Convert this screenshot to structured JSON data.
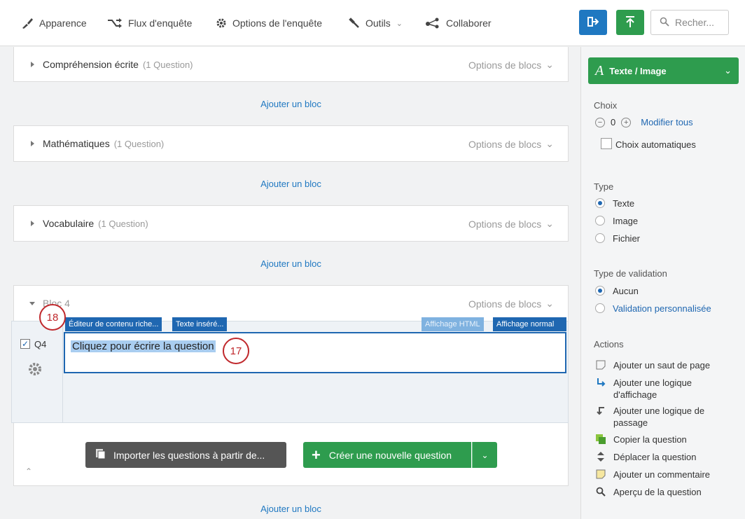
{
  "nav": {
    "apparence": "Apparence",
    "flux": "Flux d'enquête",
    "options": "Options de l'enquête",
    "outils": "Outils",
    "collaborer": "Collaborer"
  },
  "search": {
    "placeholder": "Recher..."
  },
  "blocks": [
    {
      "title": "Compréhension écrite",
      "count": "(1 Question)",
      "options": "Options de blocs"
    },
    {
      "title": "Mathématiques",
      "count": "(1 Question)",
      "options": "Options de blocs"
    },
    {
      "title": "Vocabulaire",
      "count": "(1 Question)",
      "options": "Options de blocs"
    },
    {
      "title": "Bloc 4",
      "count": "",
      "options": "Options de blocs"
    }
  ],
  "add_block": "Ajouter un bloc",
  "question": {
    "id": "Q4",
    "text": "Cliquez pour écrire la question",
    "toolbar_rich": "Éditeur de contenu riche...",
    "toolbar_piped": "Texte inséré...",
    "toolbar_html": "Affichage HTML",
    "toolbar_normal": "Affichage normal"
  },
  "callouts": {
    "c18": "18",
    "c17": "17"
  },
  "bottom": {
    "import": "Importer les questions à partir de...",
    "create": "Créer une nouvelle question"
  },
  "side": {
    "qtype": "Texte / Image",
    "choix_title": "Choix",
    "choix_value": "0",
    "modifier_tous": "Modifier tous",
    "choix_auto": "Choix automatiques",
    "type_title": "Type",
    "type_options": [
      "Texte",
      "Image",
      "Fichier"
    ],
    "validation_title": "Type de validation",
    "validation_options": [
      "Aucun",
      "Validation personnalisée"
    ],
    "actions_title": "Actions",
    "actions": [
      "Ajouter un saut de page",
      "Ajouter une logique d'affichage",
      "Ajouter une logique de passage",
      "Copier la question",
      "Déplacer la question",
      "Ajouter un commentaire",
      "Aperçu de la question"
    ]
  },
  "colors": {
    "accent_blue": "#1f67b1",
    "green": "#2e9c4e",
    "callout_red": "#c0282c"
  }
}
